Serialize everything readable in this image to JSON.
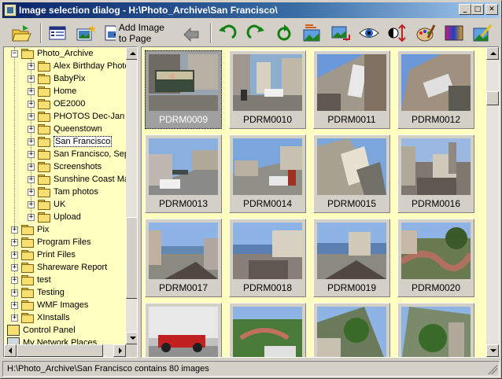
{
  "window": {
    "title": "Image selection dialog - H:\\Photo_Archive\\San Francisco\\",
    "controls": [
      "minimize",
      "maximize",
      "close"
    ]
  },
  "toolbar": {
    "add_image_label": "Add Image to Page",
    "icons": [
      "open-folder-icon",
      "details-view-icon",
      "new-image-icon",
      "add-image-icon",
      "back-arrow-icon",
      "rotate-left-icon",
      "rotate-right-icon",
      "refresh-icon",
      "landscape-adjust-icon",
      "resize-image-icon",
      "view-eye-icon",
      "contrast-icon",
      "color-palette-icon",
      "gradient-image-icon",
      "edit-image-icon"
    ]
  },
  "tree": {
    "items": [
      {
        "label": "Photo_Archive",
        "expander": "−"
      },
      {
        "label": "Alex Birthday Photo",
        "expander": "+"
      },
      {
        "label": "BabyPix",
        "expander": "+"
      },
      {
        "label": "Home",
        "expander": "+"
      },
      {
        "label": "OE2000",
        "expander": "+"
      },
      {
        "label": "PHOTOS Dec-Jan",
        "expander": "+"
      },
      {
        "label": "Queenstown",
        "expander": "+"
      },
      {
        "label": "San Francisco",
        "expander": "+",
        "selected": true
      },
      {
        "label": "San Francisco, Sep",
        "expander": "+"
      },
      {
        "label": "Screenshots",
        "expander": "+"
      },
      {
        "label": "Sunshine Coast Ma",
        "expander": "+"
      },
      {
        "label": "Tam photos",
        "expander": "+"
      },
      {
        "label": "UK",
        "expander": "+"
      },
      {
        "label": "Upload",
        "expander": "+"
      },
      {
        "label": "Pix",
        "expander": "+"
      },
      {
        "label": "Program Files",
        "expander": "+"
      },
      {
        "label": "Print Files",
        "expander": "+"
      },
      {
        "label": "Shareware Report",
        "expander": "+"
      },
      {
        "label": "test",
        "expander": "+"
      },
      {
        "label": "Testing",
        "expander": "+"
      },
      {
        "label": "WMF Images",
        "expander": "+"
      },
      {
        "label": "XInstalls",
        "expander": "+"
      },
      {
        "label": "Control Panel",
        "expander": ""
      },
      {
        "label": "My Network Places",
        "expander": ""
      }
    ]
  },
  "thumbnails": [
    {
      "name": "PDRM0009",
      "selected": true,
      "scene": "cablecar"
    },
    {
      "name": "PDRM0010",
      "scene": "street"
    },
    {
      "name": "PDRM0011",
      "scene": "tilted-car"
    },
    {
      "name": "PDRM0012",
      "scene": "tilted-car2"
    },
    {
      "name": "PDRM0013",
      "scene": "hill-street"
    },
    {
      "name": "PDRM0014",
      "scene": "hill-street2"
    },
    {
      "name": "PDRM0015",
      "scene": "tilted-houses"
    },
    {
      "name": "PDRM0016",
      "scene": "city-view"
    },
    {
      "name": "PDRM0017",
      "scene": "bay-view"
    },
    {
      "name": "PDRM0018",
      "scene": "bay-view2"
    },
    {
      "name": "PDRM0019",
      "scene": "bay-view3"
    },
    {
      "name": "PDRM0020",
      "scene": "lombard"
    },
    {
      "name": "",
      "scene": "red-car"
    },
    {
      "name": "",
      "scene": "garden"
    },
    {
      "name": "",
      "scene": "tilted-trees"
    },
    {
      "name": "",
      "scene": "tilted-trees2"
    }
  ],
  "status": {
    "text": "H:\\Photo_Archive\\San Francisco contains 80 images"
  },
  "colors": {
    "panel_bg": "#ffffc0",
    "title_start": "#0a246a",
    "title_end": "#a6caf0",
    "chrome": "#d4d0c8"
  }
}
